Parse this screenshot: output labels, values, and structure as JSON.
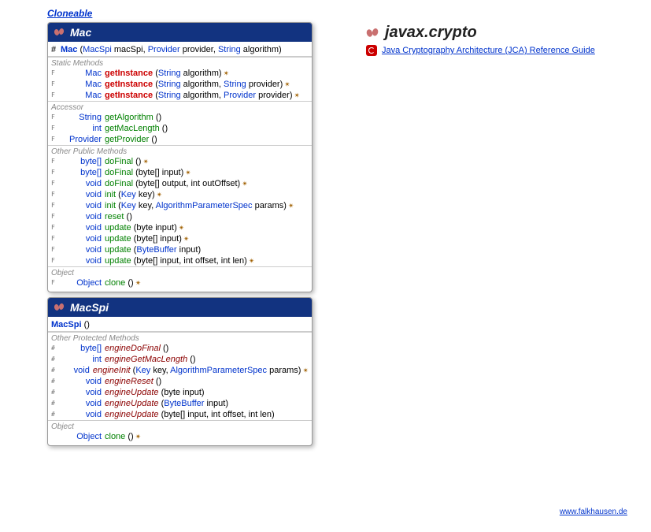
{
  "interfaceLink": "Cloneable",
  "package": {
    "name": "javax.crypto",
    "refLink": "Java Cryptography Architecture (JCA) Reference Guide"
  },
  "footer": "www.falkhausen.de",
  "classes": [
    {
      "name": "Mac",
      "constructor": {
        "vis": "#",
        "name": "Mac",
        "params": [
          {
            "type": "MacSpi",
            "name": "macSpi"
          },
          {
            "type": "Provider",
            "name": "provider"
          },
          {
            "type": "String",
            "name": "algorithm"
          }
        ]
      },
      "sections": [
        {
          "label": "Static Methods",
          "methods": [
            {
              "mod": "F",
              "ret": "Mac",
              "name": "getInstance",
              "style": "red",
              "params": "(String algorithm)",
              "throws": true
            },
            {
              "mod": "F",
              "ret": "Mac",
              "name": "getInstance",
              "style": "red",
              "params": "(String algorithm, String provider)",
              "throws": true
            },
            {
              "mod": "F",
              "ret": "Mac",
              "name": "getInstance",
              "style": "red",
              "params": "(String algorithm, Provider provider)",
              "throws": true
            }
          ]
        },
        {
          "label": "Accessor",
          "methods": [
            {
              "mod": "F",
              "ret": "String",
              "name": "getAlgorithm",
              "style": "normal",
              "params": "()"
            },
            {
              "mod": "F",
              "ret": "int",
              "name": "getMacLength",
              "style": "normal",
              "params": "()"
            },
            {
              "mod": "F",
              "ret": "Provider",
              "name": "getProvider",
              "style": "normal",
              "params": "()"
            }
          ]
        },
        {
          "label": "Other Public Methods",
          "methods": [
            {
              "mod": "F",
              "ret": "byte[]",
              "name": "doFinal",
              "style": "normal",
              "params": "()",
              "throws": true
            },
            {
              "mod": "F",
              "ret": "byte[]",
              "name": "doFinal",
              "style": "normal",
              "params": "(byte[] input)",
              "throws": true
            },
            {
              "mod": "F",
              "ret": "void",
              "name": "doFinal",
              "style": "normal",
              "params": "(byte[] output, int outOffset)",
              "throws": true
            },
            {
              "mod": "F",
              "ret": "void",
              "name": "init",
              "style": "normal",
              "params": "(Key key)",
              "throws": true
            },
            {
              "mod": "F",
              "ret": "void",
              "name": "init",
              "style": "normal",
              "params": "(Key key, AlgorithmParameterSpec params)",
              "throws": true
            },
            {
              "mod": "F",
              "ret": "void",
              "name": "reset",
              "style": "normal",
              "params": "()"
            },
            {
              "mod": "F",
              "ret": "void",
              "name": "update",
              "style": "normal",
              "params": "(byte input)",
              "throws": true
            },
            {
              "mod": "F",
              "ret": "void",
              "name": "update",
              "style": "normal",
              "params": "(byte[] input)",
              "throws": true
            },
            {
              "mod": "F",
              "ret": "void",
              "name": "update",
              "style": "normal",
              "params": "(ByteBuffer input)"
            },
            {
              "mod": "F",
              "ret": "void",
              "name": "update",
              "style": "normal",
              "params": "(byte[] input, int offset, int len)",
              "throws": true
            }
          ]
        },
        {
          "label": "Object",
          "methods": [
            {
              "mod": "F",
              "ret": "Object",
              "name": "clone",
              "style": "normal",
              "params": "()",
              "throws": true
            }
          ]
        }
      ]
    },
    {
      "name": "MacSpi",
      "constructor": {
        "vis": "",
        "name": "MacSpi",
        "params": []
      },
      "sections": [
        {
          "label": "Other Protected Methods",
          "methods": [
            {
              "mod": "#",
              "ret": "byte[]",
              "name": "engineDoFinal",
              "style": "darkred",
              "params": "()"
            },
            {
              "mod": "#",
              "ret": "int",
              "name": "engineGetMacLength",
              "style": "darkred",
              "params": "()"
            },
            {
              "mod": "#",
              "ret": "void",
              "name": "engineInit",
              "style": "darkred",
              "params": "(Key key, AlgorithmParameterSpec params)",
              "throws": true
            },
            {
              "mod": "#",
              "ret": "void",
              "name": "engineReset",
              "style": "darkred",
              "params": "()"
            },
            {
              "mod": "#",
              "ret": "void",
              "name": "engineUpdate",
              "style": "darkred",
              "params": "(byte input)"
            },
            {
              "mod": "#",
              "ret": "void",
              "name": "engineUpdate",
              "style": "darkred",
              "params": "(ByteBuffer input)"
            },
            {
              "mod": "#",
              "ret": "void",
              "name": "engineUpdate",
              "style": "darkred",
              "params": "(byte[] input, int offset, int len)"
            }
          ]
        },
        {
          "label": "Object",
          "methods": [
            {
              "mod": "",
              "ret": "Object",
              "name": "clone",
              "style": "normal",
              "params": "()",
              "throws": true
            }
          ]
        }
      ]
    }
  ]
}
